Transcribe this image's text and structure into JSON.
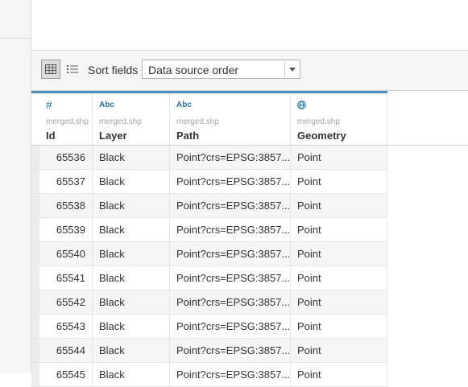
{
  "toolbar": {
    "sort_label": "Sort fields",
    "sort_value": "Data source order"
  },
  "columns": [
    {
      "type_icon": "#",
      "icon_name": "number-type-icon",
      "source": "merged.shp",
      "name": "Id"
    },
    {
      "type_icon": "Abc",
      "icon_name": "string-type-icon",
      "source": "merged.shp",
      "name": "Layer"
    },
    {
      "type_icon": "Abc",
      "icon_name": "string-type-icon",
      "source": "merged.shp",
      "name": "Path"
    },
    {
      "type_icon": "globe",
      "icon_name": "globe-icon",
      "source": "merged.shp",
      "name": "Geometry"
    }
  ],
  "rows": [
    {
      "id": "65536",
      "layer": "Black",
      "path": "Point?crs=EPSG:3857...",
      "geometry": "Point"
    },
    {
      "id": "65537",
      "layer": "Black",
      "path": "Point?crs=EPSG:3857...",
      "geometry": "Point"
    },
    {
      "id": "65538",
      "layer": "Black",
      "path": "Point?crs=EPSG:3857...",
      "geometry": "Point"
    },
    {
      "id": "65539",
      "layer": "Black",
      "path": "Point?crs=EPSG:3857...",
      "geometry": "Point"
    },
    {
      "id": "65540",
      "layer": "Black",
      "path": "Point?crs=EPSG:3857...",
      "geometry": "Point"
    },
    {
      "id": "65541",
      "layer": "Black",
      "path": "Point?crs=EPSG:3857...",
      "geometry": "Point"
    },
    {
      "id": "65542",
      "layer": "Black",
      "path": "Point?crs=EPSG:3857...",
      "geometry": "Point"
    },
    {
      "id": "65543",
      "layer": "Black",
      "path": "Point?crs=EPSG:3857...",
      "geometry": "Point"
    },
    {
      "id": "65544",
      "layer": "Black",
      "path": "Point?crs=EPSG:3857...",
      "geometry": "Point"
    },
    {
      "id": "65545",
      "layer": "Black",
      "path": "Point?crs=EPSG:3857...",
      "geometry": "Point"
    }
  ],
  "colors": {
    "accent": "#4f8fbf",
    "type_icon": "#1f6fae",
    "alt_row": "#f5f5f5"
  }
}
